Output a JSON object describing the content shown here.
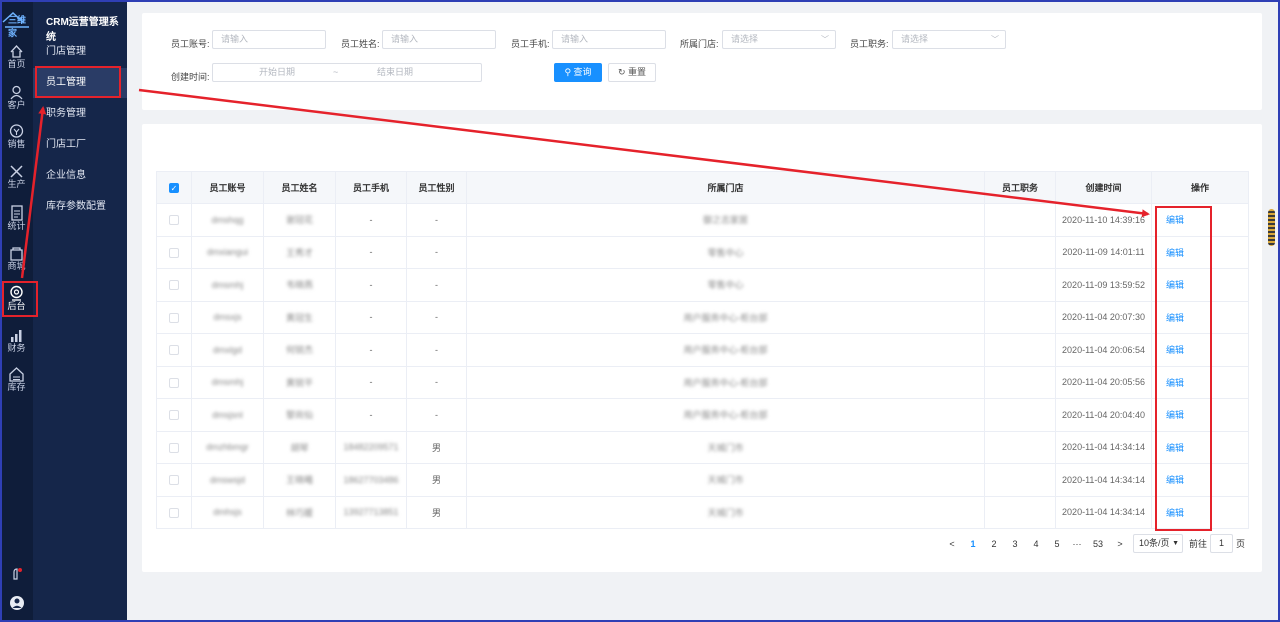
{
  "app": {
    "logo_text": "三维家",
    "title": "CRM运营管理系统"
  },
  "rail": [
    {
      "label": "首页",
      "icon": "home-icon"
    },
    {
      "label": "客户",
      "icon": "customer-icon"
    },
    {
      "label": "销售",
      "icon": "sales-icon"
    },
    {
      "label": "生产",
      "icon": "production-icon"
    },
    {
      "label": "统计",
      "icon": "statistics-icon"
    },
    {
      "label": "商城",
      "icon": "mall-icon"
    },
    {
      "label": "后台",
      "icon": "backend-icon"
    },
    {
      "label": "财务",
      "icon": "finance-icon"
    },
    {
      "label": "库存",
      "icon": "inventory-icon"
    }
  ],
  "subnav": {
    "items": [
      {
        "label": "门店管理"
      },
      {
        "label": "员工管理"
      },
      {
        "label": "职务管理"
      },
      {
        "label": "门店工厂"
      },
      {
        "label": "企业信息"
      },
      {
        "label": "库存参数配置"
      }
    ],
    "active_index": 1
  },
  "filters": {
    "account_label": "员工账号:",
    "account_placeholder": "请输入",
    "name_label": "员工姓名:",
    "name_placeholder": "请输入",
    "phone_label": "员工手机:",
    "phone_placeholder": "请输入",
    "store_label": "所属门店:",
    "store_placeholder": "请选择",
    "position_label": "员工职务:",
    "position_placeholder": "请选择",
    "date_label": "创建时间:",
    "date_start_placeholder": "开始日期",
    "date_separator": "~",
    "date_end_placeholder": "结束日期",
    "search_button": "查询",
    "reset_button": "重置"
  },
  "table": {
    "headers": {
      "account": "员工账号",
      "name": "员工姓名",
      "phone": "员工手机",
      "gender": "员工性别",
      "store": "所属门店",
      "position": "员工职务",
      "created": "创建时间",
      "action": "操作"
    },
    "action_label": "编辑",
    "rows": [
      {
        "account": "dmshqg",
        "name": "谢冠花",
        "phone": "-",
        "gender": "-",
        "store": "御之志家居",
        "position": "",
        "created": "2020-11-10 14:39:16"
      },
      {
        "account": "dmxiangui",
        "name": "王秀才",
        "phone": "-",
        "gender": "-",
        "store": "零售中心",
        "position": "",
        "created": "2020-11-09 14:01:11"
      },
      {
        "account": "dmsmhj",
        "name": "韦晓燕",
        "phone": "-",
        "gender": "-",
        "store": "零售中心",
        "position": "",
        "created": "2020-11-09 13:59:52"
      },
      {
        "account": "dmsxjs",
        "name": "黄冠生",
        "phone": "-",
        "gender": "-",
        "store": "用户服务中心-柜台部",
        "position": "",
        "created": "2020-11-04 20:07:30"
      },
      {
        "account": "dmxlgd",
        "name": "何锐杰",
        "phone": "-",
        "gender": "-",
        "store": "用户服务中心-柜台部",
        "position": "",
        "created": "2020-11-04 20:06:54"
      },
      {
        "account": "dmsmhj",
        "name": "黄锐平",
        "phone": "-",
        "gender": "-",
        "store": "用户服务中心-柜台部",
        "position": "",
        "created": "2020-11-04 20:05:56"
      },
      {
        "account": "dmsjsnl",
        "name": "黎尚仙",
        "phone": "-",
        "gender": "-",
        "store": "用户服务中心-柜台部",
        "position": "",
        "created": "2020-11-04 20:04:40"
      },
      {
        "account": "dmzhbmgr",
        "name": "胡琴",
        "phone": "18482209571",
        "gender": "男",
        "store": "天城门市",
        "position": "",
        "created": "2020-11-04 14:34:14"
      },
      {
        "account": "dmswsjd",
        "name": "王晓曦",
        "phone": "18627703486",
        "gender": "男",
        "store": "天城门市",
        "position": "",
        "created": "2020-11-04 14:34:14"
      },
      {
        "account": "dmhsjs",
        "name": "林巧媛",
        "phone": "13927713851",
        "gender": "男",
        "store": "天城门市",
        "position": "",
        "created": "2020-11-04 14:34:14"
      }
    ]
  },
  "pagination": {
    "prev": "<",
    "pages": [
      "1",
      "2",
      "3",
      "4",
      "5"
    ],
    "ellipsis": "···",
    "last": "53",
    "next": ">",
    "page_size": "10条/页",
    "goto_label": "前往",
    "goto_value": "1",
    "page_suffix": "页"
  },
  "colors": {
    "sidebar": "#0f1d3a",
    "subnav": "#15264a",
    "primary": "#1890ff",
    "annotation": "#e5222b"
  }
}
